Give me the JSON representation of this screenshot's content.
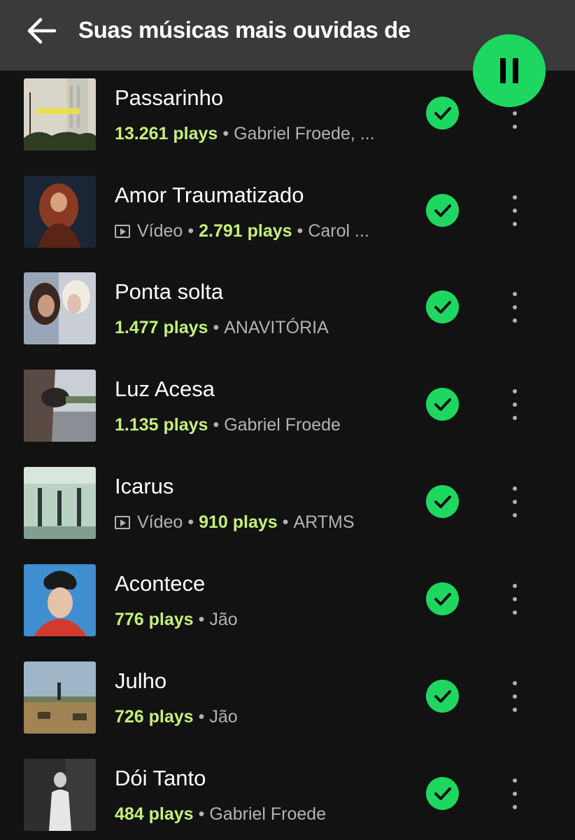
{
  "header": {
    "title": "Suas músicas mais ouvidas de",
    "back_icon": "arrow-left-icon",
    "play_state_icon": "pause-icon"
  },
  "colors": {
    "background": "#121212",
    "header": "#3a3a3a",
    "accent": "#1ed760",
    "plays": "#c5f07a",
    "secondary_text": "#b3b3b3"
  },
  "tracks": [
    {
      "title": "Passarinho",
      "video": false,
      "video_label": "",
      "plays": "13.261 plays",
      "artist": "Gabriel Froede, ..."
    },
    {
      "title": "Amor Traumatizado",
      "video": true,
      "video_label": "Vídeo",
      "plays": "2.791 plays",
      "artist": "Carol ..."
    },
    {
      "title": "Ponta solta",
      "video": false,
      "video_label": "",
      "plays": "1.477 plays",
      "artist": "ANAVITÓRIA"
    },
    {
      "title": "Luz Acesa",
      "video": false,
      "video_label": "",
      "plays": "1.135 plays",
      "artist": "Gabriel Froede"
    },
    {
      "title": "Icarus",
      "video": true,
      "video_label": "Vídeo",
      "plays": "910 plays",
      "artist": "ARTMS"
    },
    {
      "title": "Acontece",
      "video": false,
      "video_label": "",
      "plays": "776 plays",
      "artist": "Jão"
    },
    {
      "title": "Julho",
      "video": false,
      "video_label": "",
      "plays": "726 plays",
      "artist": "Jão"
    },
    {
      "title": "Dói Tanto",
      "video": false,
      "video_label": "",
      "plays": "484 plays",
      "artist": "Gabriel Froede"
    }
  ]
}
